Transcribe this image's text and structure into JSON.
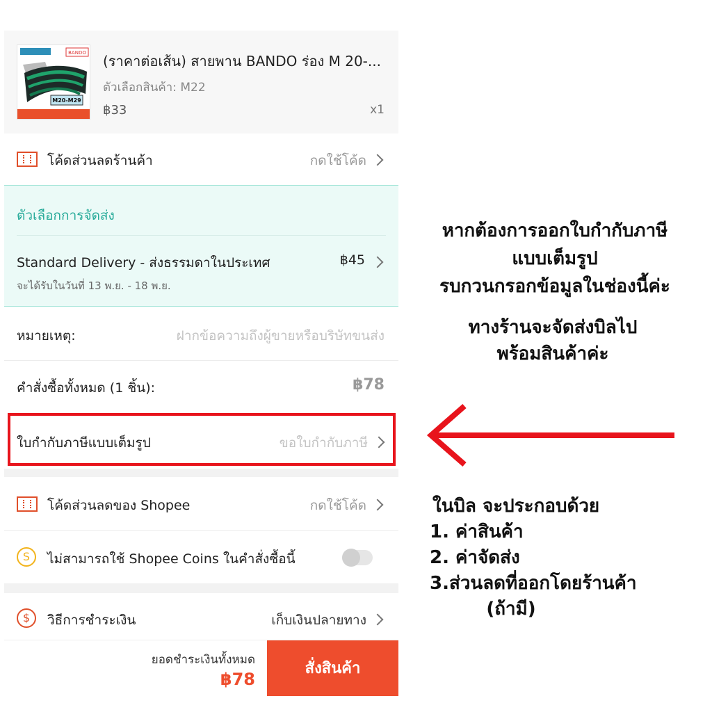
{
  "product": {
    "title": "(ราคาต่อเส้น) สายพาน BANDO ร่อง M 20-...",
    "variant": "ตัวเลือกสินค้า: M22",
    "price": "฿33",
    "qty": "x1",
    "image_brand": "BANDO",
    "image_range": "M20-M29"
  },
  "shop_voucher": {
    "label": "โค้ดส่วนลดร้านค้า",
    "action": "กดใช้โค้ด"
  },
  "shipping": {
    "heading": "ตัวเลือกการจัดส่ง",
    "method": "Standard Delivery - ส่งธรรมดาในประเทศ",
    "price": "฿45",
    "eta": "จะได้รับในวันที่ 13 พ.ย. - 18 พ.ย."
  },
  "note": {
    "label": "หมายเหตุ:",
    "placeholder": "ฝากข้อความถึงผู้ขายหรือบริษัทขนส่ง"
  },
  "order_total": {
    "label": "คำสั่งซื้อทั้งหมด (1 ชิ้น):",
    "value": "฿78"
  },
  "tax_invoice": {
    "label": "ใบกำกับภาษีแบบเต็มรูป",
    "action": "ขอใบกำกับภาษี"
  },
  "shopee_voucher": {
    "label": "โค้ดส่วนลดของ Shopee",
    "action": "กดใช้โค้ด"
  },
  "coins": {
    "label": "ไม่สามารถใช้ Shopee Coins ในคำสั่งซื้อนี้",
    "icon": "S"
  },
  "payment": {
    "label": "วิธีการชำระเงิน",
    "value": "เก็บเงินปลายทาง",
    "icon": "$"
  },
  "bottom": {
    "grand_label": "ยอดชำระเงินทั้งหมด",
    "grand_value": "฿78",
    "order_button": "สั่งสินค้า"
  },
  "annotations": {
    "invoice_note": [
      "หากต้องการออกใบกำกับภาษี",
      "แบบเต็มรูป",
      "รบกวนกรอกข้อมูลในช่องนี้ค่ะ"
    ],
    "shipping_note": [
      "ทางร้านจะจัดส่งบิลไป",
      "พร้อมสินค้าค่ะ"
    ],
    "bill_title": "ในบิล จะประกอบด้วย",
    "bill_items": [
      "1. ค่าสินค้า",
      "2. ค่าจัดส่ง",
      "3.ส่วนลดที่ออกโดยร้านค้า"
    ],
    "bill_last": "(ถ้ามี)"
  },
  "colors": {
    "accent": "#ee4d2d",
    "highlight_box": "#e8141c",
    "shipping_bg": "#ebfaf7",
    "shipping_text": "#26aa99"
  }
}
